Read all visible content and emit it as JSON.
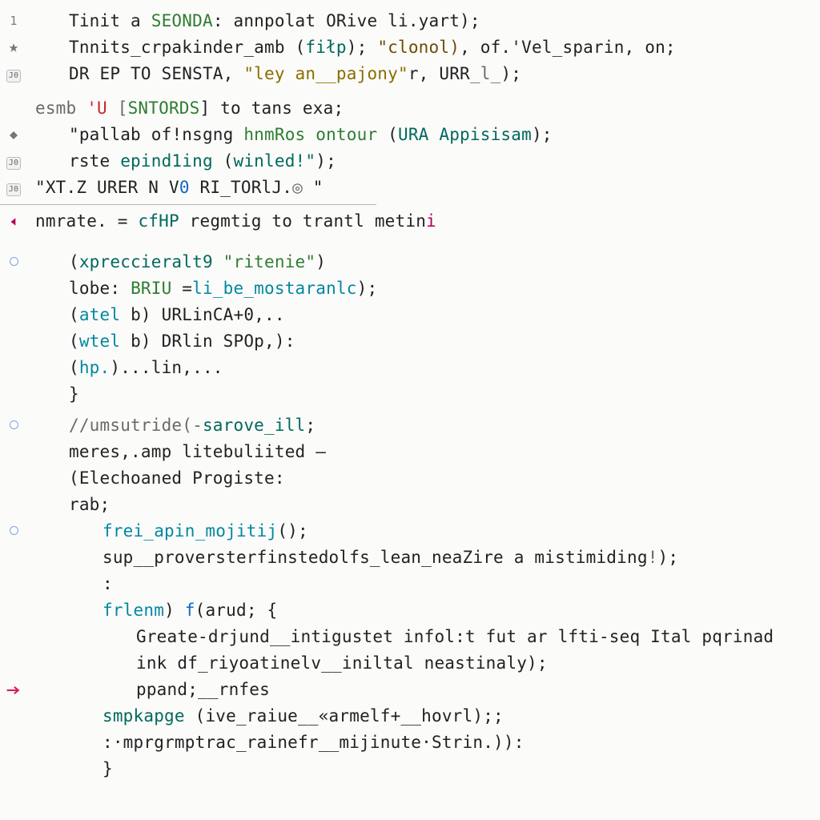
{
  "colors": {
    "default": "#222222",
    "green": "#2e7d32",
    "teal": "#00695c",
    "blue": "#1565c0",
    "cyan": "#0288a0",
    "brown": "#6d4c00",
    "purple": "#7b1fa2",
    "grey": "#6a6a6a",
    "magenta": "#b4005a",
    "gold": "#8a6d00",
    "red": "#c62828"
  },
  "lines": [
    {
      "gutter": {
        "type": "lineno",
        "value": "1"
      },
      "indent": 1,
      "tokens": [
        {
          "t": "Tinit a ",
          "c": "default"
        },
        {
          "t": "SEONDA",
          "c": "green"
        },
        {
          "t": ": annpolat ",
          "c": "default"
        },
        {
          "t": "ORive",
          "c": "default"
        },
        {
          "t": " li.yart);",
          "c": "default"
        }
      ]
    },
    {
      "gutter": {
        "type": "glyph",
        "value": "star"
      },
      "indent": 1,
      "tokens": [
        {
          "t": "Tnnits_crpakinder_amb ",
          "c": "default"
        },
        {
          "t": "(",
          "c": "default"
        },
        {
          "t": "fiłp",
          "c": "teal"
        },
        {
          "t": "); ",
          "c": "default"
        },
        {
          "t": "\"clonol)",
          "c": "brown"
        },
        {
          "t": ", of.'Vel_sparin, on;",
          "c": "default"
        }
      ]
    },
    {
      "gutter": {
        "type": "badge",
        "value": "J0"
      },
      "indent": 1,
      "tokens": [
        {
          "t": "DR EP TO SENSTA, ",
          "c": "default"
        },
        {
          "t": "\"ley an__pajony\"",
          "c": "gold"
        },
        {
          "t": "r, URR",
          "c": "default"
        },
        {
          "t": "_l_",
          "c": "grey"
        },
        {
          "t": ");",
          "c": "default"
        }
      ]
    },
    {
      "spacer": 10
    },
    {
      "gutter": {
        "type": "none"
      },
      "indent": 0,
      "tokens": [
        {
          "t": "esmb ",
          "c": "grey"
        },
        {
          "t": "'U ",
          "c": "red"
        },
        {
          "t": "[",
          "c": "grey"
        },
        {
          "t": "SNTORDS",
          "c": "green"
        },
        {
          "t": "] to tans exa;",
          "c": "default"
        }
      ]
    },
    {
      "gutter": {
        "type": "glyph",
        "value": "diamond"
      },
      "indent": 1,
      "tokens": [
        {
          "t": "\"pallab of",
          "c": "default"
        },
        {
          "t": "!nsgng ",
          "c": "default"
        },
        {
          "t": "hnmRos ontour ",
          "c": "green"
        },
        {
          "t": "(",
          "c": "default"
        },
        {
          "t": "URA Appisisam",
          "c": "teal"
        },
        {
          "t": ");",
          "c": "default"
        }
      ]
    },
    {
      "gutter": {
        "type": "badge",
        "value": "J0"
      },
      "indent": 1,
      "tokens": [
        {
          "t": "rste ",
          "c": "default"
        },
        {
          "t": "epind1ing ",
          "c": "teal"
        },
        {
          "t": "(",
          "c": "default"
        },
        {
          "t": "winled!\"",
          "c": "teal"
        },
        {
          "t": ");",
          "c": "default"
        }
      ]
    },
    {
      "gutter": {
        "type": "badge",
        "value": "J0"
      },
      "indent": 0,
      "tokens": [
        {
          "t": "\"XT.Z URER N V",
          "c": "default"
        },
        {
          "t": "0",
          "c": "blue"
        },
        {
          "t": " RI_TORlJ.",
          "c": "default"
        },
        {
          "t": "◎",
          "c": "grey"
        },
        {
          "t": " \"",
          "c": "default"
        }
      ]
    },
    {
      "divider": true
    },
    {
      "gutter": {
        "type": "glyph",
        "value": "tri-left"
      },
      "indent": 0,
      "tokens": [
        {
          "t": "nmrate. = ",
          "c": "default"
        },
        {
          "t": "cfHP",
          "c": "teal"
        },
        {
          "t": " regmtig to trantl metin",
          "c": "default"
        },
        {
          "t": "i",
          "c": "magenta"
        }
      ]
    },
    {
      "spacer": 18
    },
    {
      "gutter": {
        "type": "bp-empty"
      },
      "indent": 1,
      "tokens": [
        {
          "t": "(",
          "c": "default"
        },
        {
          "t": "xpreccieralt9",
          "c": "teal"
        },
        {
          "t": " ",
          "c": "default"
        },
        {
          "t": "\"ritenie\"",
          "c": "green"
        },
        {
          "t": ")",
          "c": "default"
        }
      ]
    },
    {
      "gutter": {
        "type": "none"
      },
      "indent": 1,
      "tokens": [
        {
          "t": "lobe: ",
          "c": "default"
        },
        {
          "t": "BRIU",
          "c": "green"
        },
        {
          "t": " =",
          "c": "default"
        },
        {
          "t": "li_be_mostaranlc",
          "c": "cyan"
        },
        {
          "t": ");",
          "c": "default"
        }
      ]
    },
    {
      "gutter": {
        "type": "none"
      },
      "indent": 1,
      "tokens": [
        {
          "t": "(",
          "c": "default"
        },
        {
          "t": "atel ",
          "c": "cyan"
        },
        {
          "t": "b) ",
          "c": "default"
        },
        {
          "t": "URLinCA+0",
          "c": "default"
        },
        {
          "t": ",..",
          "c": "default"
        }
      ]
    },
    {
      "gutter": {
        "type": "none"
      },
      "indent": 1,
      "tokens": [
        {
          "t": "(",
          "c": "default"
        },
        {
          "t": "wtel ",
          "c": "cyan"
        },
        {
          "t": "b) ",
          "c": "default"
        },
        {
          "t": "DRlin SPOp",
          "c": "default"
        },
        {
          "t": ",):",
          "c": "default"
        }
      ]
    },
    {
      "gutter": {
        "type": "none"
      },
      "indent": 1,
      "tokens": [
        {
          "t": "(",
          "c": "default"
        },
        {
          "t": "hp.",
          "c": "cyan"
        },
        {
          "t": ")...lin,...",
          "c": "default"
        }
      ]
    },
    {
      "gutter": {
        "type": "none"
      },
      "indent": 1,
      "tokens": [
        {
          "t": "}",
          "c": "default"
        }
      ]
    },
    {
      "spacer": 6
    },
    {
      "gutter": {
        "type": "bp-empty"
      },
      "indent": 1,
      "tokens": [
        {
          "t": "//umsutride(-",
          "c": "grey"
        },
        {
          "t": "sarove_ill",
          "c": "teal"
        },
        {
          "t": ";",
          "c": "default"
        }
      ]
    },
    {
      "gutter": {
        "type": "none"
      },
      "indent": 1,
      "tokens": [
        {
          "t": "meres,.amp litebuliited –",
          "c": "default"
        }
      ]
    },
    {
      "gutter": {
        "type": "none"
      },
      "indent": 1,
      "tokens": [
        {
          "t": "(",
          "c": "default"
        },
        {
          "t": "Elechoaned ",
          "c": "default"
        },
        {
          "t": "Progiste",
          "c": "default"
        },
        {
          "t": ":",
          "c": "default"
        }
      ]
    },
    {
      "gutter": {
        "type": "none"
      },
      "indent": 1,
      "tokens": [
        {
          "t": "rab;",
          "c": "default"
        }
      ]
    },
    {
      "gutter": {
        "type": "bp-empty"
      },
      "indent": 2,
      "tokens": [
        {
          "t": "frei_apin_mojitij",
          "c": "cyan"
        },
        {
          "t": "();",
          "c": "default"
        }
      ]
    },
    {
      "gutter": {
        "type": "none"
      },
      "indent": 2,
      "tokens": [
        {
          "t": "sup__proversterfinstedolfs_lean_neaZire a mistimiding",
          "c": "default"
        },
        {
          "t": "!",
          "c": "grey"
        },
        {
          "t": ");",
          "c": "default"
        }
      ]
    },
    {
      "gutter": {
        "type": "none"
      },
      "indent": 2,
      "tokens": [
        {
          "t": ":",
          "c": "default"
        }
      ]
    },
    {
      "gutter": {
        "type": "none"
      },
      "indent": 2,
      "tokens": [
        {
          "t": "frlenm",
          "c": "cyan"
        },
        {
          "t": ") ",
          "c": "default"
        },
        {
          "t": "f",
          "c": "blue"
        },
        {
          "t": "(",
          "c": "default"
        },
        {
          "t": "arud",
          "c": "default"
        },
        {
          "t": "; {",
          "c": "default"
        }
      ]
    },
    {
      "gutter": {
        "type": "none"
      },
      "indent": 3,
      "tokens": [
        {
          "t": "Greate-drjund__intigustet infol:t fut ar lfti-seq Ital pqrinad",
          "c": "default"
        }
      ]
    },
    {
      "gutter": {
        "type": "none"
      },
      "indent": 3,
      "tokens": [
        {
          "t": "ink df_riyoatinelv__iniltal neastinaly);",
          "c": "default"
        }
      ]
    },
    {
      "gutter": {
        "type": "glyph",
        "value": "arrow-right"
      },
      "indent": 3,
      "tokens": [
        {
          "t": "ppand;__rnfes",
          "c": "default"
        }
      ]
    },
    {
      "gutter": {
        "type": "none"
      },
      "indent": 2,
      "tokens": [
        {
          "t": "smpkapge ",
          "c": "teal"
        },
        {
          "t": "(",
          "c": "default"
        },
        {
          "t": "ive_raiue__«armelf+__hovrl",
          "c": "default"
        },
        {
          "t": ");;",
          "c": "default"
        }
      ]
    },
    {
      "gutter": {
        "type": "none"
      },
      "indent": 2,
      "tokens": [
        {
          "t": ":·mprgrmptrac_rainefr__mijinute·Strin.)):",
          "c": "default"
        }
      ]
    },
    {
      "gutter": {
        "type": "none"
      },
      "indent": 2,
      "tokens": [
        {
          "t": "}",
          "c": "default"
        }
      ]
    }
  ]
}
